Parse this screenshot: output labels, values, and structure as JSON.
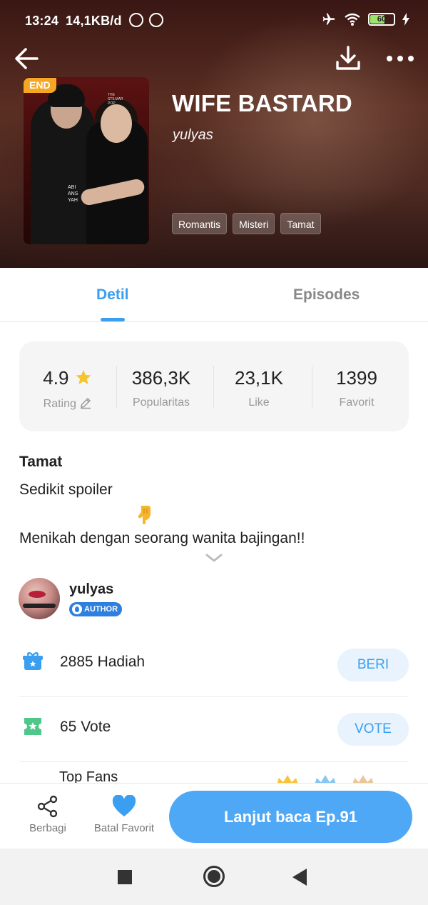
{
  "status_bar": {
    "time": "13:24",
    "network_speed": "14,1KB/d",
    "battery": "60"
  },
  "header": {
    "end_badge": "END",
    "title": "WIFE BASTARD",
    "author": "yulyas",
    "tags": [
      "Romantis",
      "Misteri",
      "Tamat"
    ],
    "cover_texts": {
      "top": "THE\nSTILMAR\nPOP",
      "side": "ABI\nANS\nYAH"
    }
  },
  "tabs": {
    "detail": "Detil",
    "episodes": "Episodes",
    "active": "detail"
  },
  "stats": [
    {
      "value": "4.9",
      "label": "Rating"
    },
    {
      "value": "386,3K",
      "label": "Popularitas"
    },
    {
      "value": "23,1K",
      "label": "Like"
    },
    {
      "value": "1399",
      "label": "Favorit"
    }
  ],
  "synopsis": {
    "status": "Tamat",
    "line1": "Sedikit spoiler",
    "emoji": "pointing-down-hand",
    "line2": "Menikah dengan seorang wanita bajingan!!"
  },
  "author_section": {
    "name": "yulyas",
    "badge": "AUTHOR"
  },
  "gift_row": {
    "count": "2885",
    "label": "Hadiah",
    "button": "BERI"
  },
  "vote_row": {
    "count": "65",
    "label": "Vote",
    "button": "VOTE"
  },
  "top_fans": {
    "label": "Top Fans"
  },
  "bottom_bar": {
    "share_label": "Berbagi",
    "favorite_label": "Batal Favorit",
    "continue_label": "Lanjut baca Ep.91"
  },
  "colors": {
    "accent": "#3a9ff0",
    "continue_button": "#4ea8f5",
    "end_badge": "#f5a623",
    "rating_star": "#f7c32e",
    "gift_icon": "#3a9ff0",
    "vote_icon": "#4fc78a"
  }
}
